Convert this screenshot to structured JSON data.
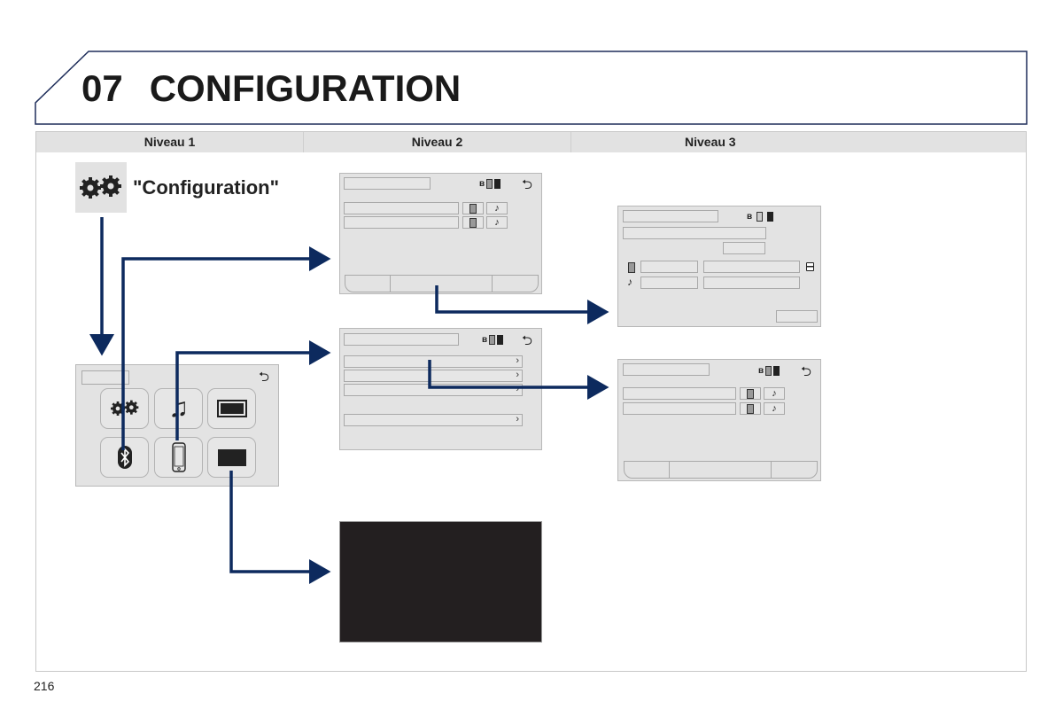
{
  "header": {
    "chapter_number": "07",
    "chapter_title": "CONFIGURATION"
  },
  "columns": [
    {
      "label": "Niveau 1"
    },
    {
      "label": "Niveau 2"
    },
    {
      "label": "Niveau 3"
    }
  ],
  "level1": {
    "entry_icon": "gears-icon",
    "entry_label": "\"Configuration\"",
    "menu_screen": {
      "back_icon": "back-arrow-icon",
      "back_glyph": "⮌",
      "tiles": [
        {
          "icon": "gears-icon"
        },
        {
          "icon": "music-note-icon",
          "glyph": "♫"
        },
        {
          "icon": "screen-outline-icon"
        },
        {
          "icon": "bluetooth-icon"
        },
        {
          "icon": "smartphone-icon"
        },
        {
          "icon": "screen-off-icon"
        }
      ]
    }
  },
  "level2": {
    "screens": [
      {
        "id": "bluetooth-devices",
        "rows": 2,
        "row_buttons": [
          "phone-icon",
          "music-note-icon"
        ],
        "has_bottom_bar": true
      },
      {
        "id": "phone-menu",
        "rows": 4,
        "chevron": "›"
      },
      {
        "id": "screen-off",
        "display": "black"
      }
    ],
    "back_glyph": "⮌",
    "note_glyph": "♪"
  },
  "level3": {
    "screens": [
      {
        "id": "device-details",
        "icons": [
          "bluetooth-icon",
          "phone-icon",
          "battery-icon",
          "phone-icon",
          "music-note-icon",
          "save-icon"
        ]
      },
      {
        "id": "device-list",
        "rows": 2,
        "row_buttons": [
          "phone-icon",
          "music-note-icon"
        ],
        "has_bottom_bar": true
      }
    ]
  },
  "colors": {
    "arrow": "#0d2a5e",
    "header_border": "#1e2d5a",
    "column_header_bg": "#e2e2e2",
    "screen_bg": "#e3e3e3",
    "black_screen": "#231f20"
  },
  "footer": {
    "page_number": "216"
  }
}
